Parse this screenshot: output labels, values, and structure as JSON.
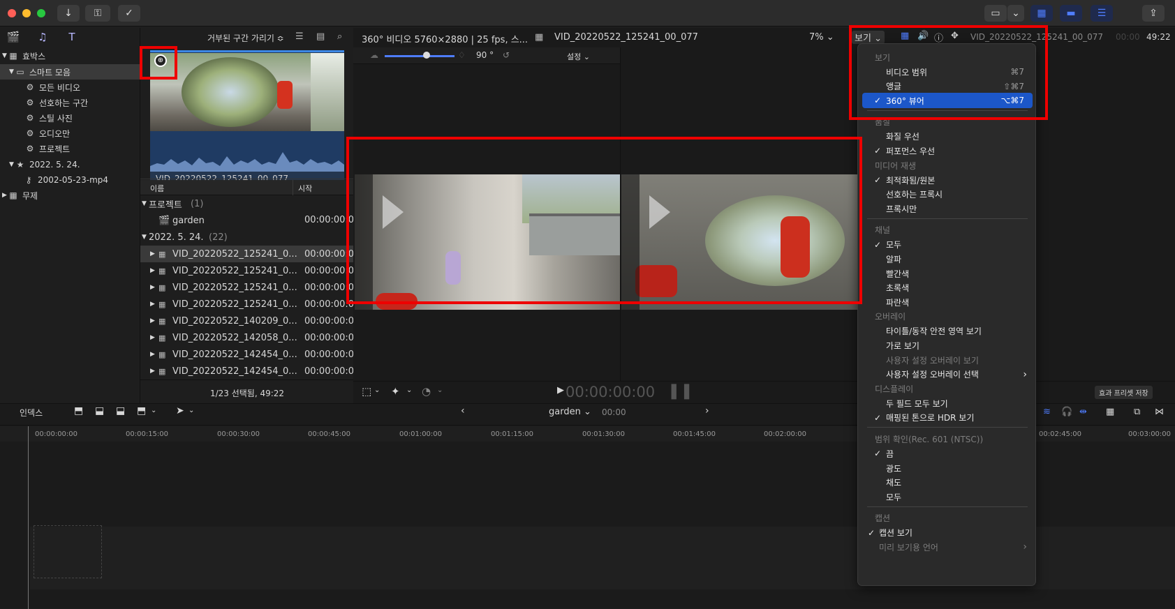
{
  "app": {
    "library_tabs": [
      "libraries-icon",
      "photos-icon",
      "titles-icon"
    ]
  },
  "sidebar": {
    "items": [
      {
        "label": "효박스",
        "level": 0,
        "tri": "▼"
      },
      {
        "label": "스마트 모음",
        "level": 1,
        "tri": "▼"
      },
      {
        "label": "모든 비디오",
        "level": 2
      },
      {
        "label": "선호하는 구간",
        "level": 2
      },
      {
        "label": "스틸 사진",
        "level": 2
      },
      {
        "label": "오디오만",
        "level": 2
      },
      {
        "label": "프로젝트",
        "level": 2
      },
      {
        "label": "2022. 5. 24.",
        "level": 1,
        "tri": "▼"
      },
      {
        "label": "2002-05-23-mp4",
        "level": 2
      },
      {
        "label": "무제",
        "level": 0,
        "tri": "▶"
      }
    ]
  },
  "browser": {
    "filter_label": "거부된 구간 가리기 ≎",
    "clip_name": "VID_20220522_125241_00_077",
    "col_name": "이름",
    "col_start": "시작",
    "group1": {
      "label": "프로젝트",
      "count": "(1)"
    },
    "project_row": {
      "name": "garden",
      "start": "00:00:00:00"
    },
    "group2": {
      "label": "2022. 5. 24.",
      "count": "(22)"
    },
    "rows": [
      {
        "name": "VID_20220522_125241_0...",
        "start": "00:00:00:00"
      },
      {
        "name": "VID_20220522_125241_0...",
        "start": "00:00:00:00"
      },
      {
        "name": "VID_20220522_125241_0...",
        "start": "00:00:00:00"
      },
      {
        "name": "VID_20220522_125241_0...",
        "start": "00:00:00:00"
      },
      {
        "name": "VID_20220522_140209_0...",
        "start": "00:00:00:00"
      },
      {
        "name": "VID_20220522_142058_0...",
        "start": "00:00:00:00"
      },
      {
        "name": "VID_20220522_142454_0...",
        "start": "00:00:00:00"
      },
      {
        "name": "VID_20220522_142454_0...",
        "start": "00:00:00:00"
      }
    ],
    "status": "1/23 선택됨, 49:22"
  },
  "viewer": {
    "format": "360° 비디오 5760×2880 | 25 fps, 스...",
    "clip_title": "VID_20220522_125241_00_077",
    "zoom": "7%",
    "view_button": "보기",
    "right_clip": "VID_20220522_125241_00_077",
    "right_time": "49:22",
    "right_time_dim": "00:00",
    "angle": "90 °",
    "settings": "설정",
    "timecode": "00:00:00:00"
  },
  "menu": {
    "items": [
      {
        "type": "header",
        "label": "보기"
      },
      {
        "type": "item",
        "label": "비디오 범위",
        "shortcut": "⌘7"
      },
      {
        "type": "item",
        "label": "앵글",
        "shortcut": "⇧⌘7"
      },
      {
        "type": "item",
        "label": "360° 뷰어",
        "shortcut": "⌥⌘7",
        "checked": true,
        "selected": true
      },
      {
        "type": "sep"
      },
      {
        "type": "header",
        "label": "품질"
      },
      {
        "type": "item",
        "label": "화질 우선"
      },
      {
        "type": "item",
        "label": "퍼포먼스 우선",
        "checked": true
      },
      {
        "type": "header",
        "label": "미디어 재생"
      },
      {
        "type": "item",
        "label": "최적화됨/원본",
        "checked": true
      },
      {
        "type": "item",
        "label": "선호하는 프록시"
      },
      {
        "type": "item",
        "label": "프록시만"
      },
      {
        "type": "sep"
      },
      {
        "type": "header",
        "label": "채널"
      },
      {
        "type": "item",
        "label": "모두",
        "checked": true
      },
      {
        "type": "item",
        "label": "알파"
      },
      {
        "type": "item",
        "label": "빨간색"
      },
      {
        "type": "item",
        "label": "초록색"
      },
      {
        "type": "item",
        "label": "파란색"
      },
      {
        "type": "header",
        "label": "오버레이"
      },
      {
        "type": "item",
        "label": "타이틀/동작 안전 영역 보기"
      },
      {
        "type": "item",
        "label": "가로 보기"
      },
      {
        "type": "item",
        "label": "사용자 설정 오버레이 보기",
        "disabled": true
      },
      {
        "type": "item",
        "label": "사용자 설정 오버레이 선택",
        "submenu": true
      },
      {
        "type": "header",
        "label": "디스플레이"
      },
      {
        "type": "item",
        "label": "두 필드 모두 보기"
      },
      {
        "type": "item",
        "label": "매핑된 톤으로 HDR 보기",
        "checked": true
      },
      {
        "type": "sep"
      },
      {
        "type": "header",
        "label": "범위 확인(Rec. 601 (NTSC))"
      },
      {
        "type": "item",
        "label": "끔",
        "checked": true
      },
      {
        "type": "item",
        "label": "광도"
      },
      {
        "type": "item",
        "label": "채도"
      },
      {
        "type": "item",
        "label": "모두"
      },
      {
        "type": "sep"
      },
      {
        "type": "header",
        "label": "캡션"
      },
      {
        "type": "item",
        "label": "캡션 보기",
        "checked": true,
        "nocheckindent": true
      },
      {
        "type": "item",
        "label": "미리 보기용 언어",
        "disabled": true,
        "submenu": true,
        "nocheckindent": true
      }
    ]
  },
  "timeline": {
    "index_label": "인덱스",
    "project": "garden",
    "time": "00:00",
    "effects_preset": "효과 프리셋 저장",
    "ruler": [
      "00:00:00:00",
      "00:00:15:00",
      "00:00:30:00",
      "00:00:45:00",
      "00:01:00:00",
      "00:01:15:00",
      "00:01:30:00",
      "00:01:45:00",
      "00:02:00:00",
      "00:02:45:00",
      "00:03:00:00"
    ]
  },
  "colors": {
    "accent": "#1c57c9",
    "highlight_red": "#ee0000",
    "selection": "#3a3a3a"
  }
}
